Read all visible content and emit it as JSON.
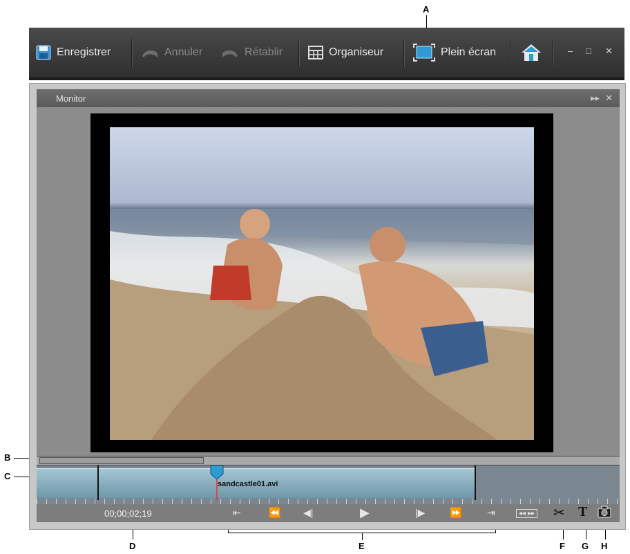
{
  "callouts": [
    "A",
    "B",
    "C",
    "D",
    "E",
    "F",
    "G",
    "H"
  ],
  "toolbar": {
    "save_label": "Enregistrer",
    "undo_label": "Annuler",
    "redo_label": "Rétablir",
    "organizer_label": "Organiseur",
    "fullscreen_label": "Plein écran"
  },
  "panel": {
    "title": "Monitor"
  },
  "clip": {
    "name": "sandcastle01.avi"
  },
  "timecode": "00;00;02;19",
  "colors": {
    "toolbar_bg": "#3a3a3a",
    "clip_blue": "#7fa8b8",
    "accent": "#2f9bd6"
  }
}
